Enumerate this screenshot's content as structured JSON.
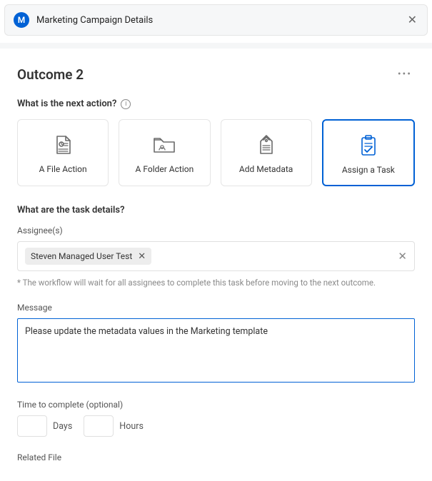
{
  "top": {
    "avatar_initial": "M",
    "title": "Marketing Campaign Details"
  },
  "panel": {
    "title": "Outcome 2",
    "question_next_action": "What is the next action?",
    "actions": {
      "file": {
        "label": "A File Action"
      },
      "folder": {
        "label": "A Folder Action"
      },
      "meta": {
        "label": "Add Metadata"
      },
      "task": {
        "label": "Assign a Task"
      }
    },
    "selected_action": "task",
    "question_task_details": "What are the task details?",
    "assignee": {
      "label": "Assignee(s)",
      "chip_name": "Steven Managed User Test",
      "note": "* The workflow will wait for all assignees to complete this task before moving to the next outcome."
    },
    "message": {
      "label": "Message",
      "value": "Please update the metadata values in the Marketing template"
    },
    "time": {
      "label": "Time to complete (optional)",
      "days_value": "",
      "days_unit": "Days",
      "hours_value": "",
      "hours_unit": "Hours"
    },
    "related_file": {
      "label": "Related File"
    }
  }
}
